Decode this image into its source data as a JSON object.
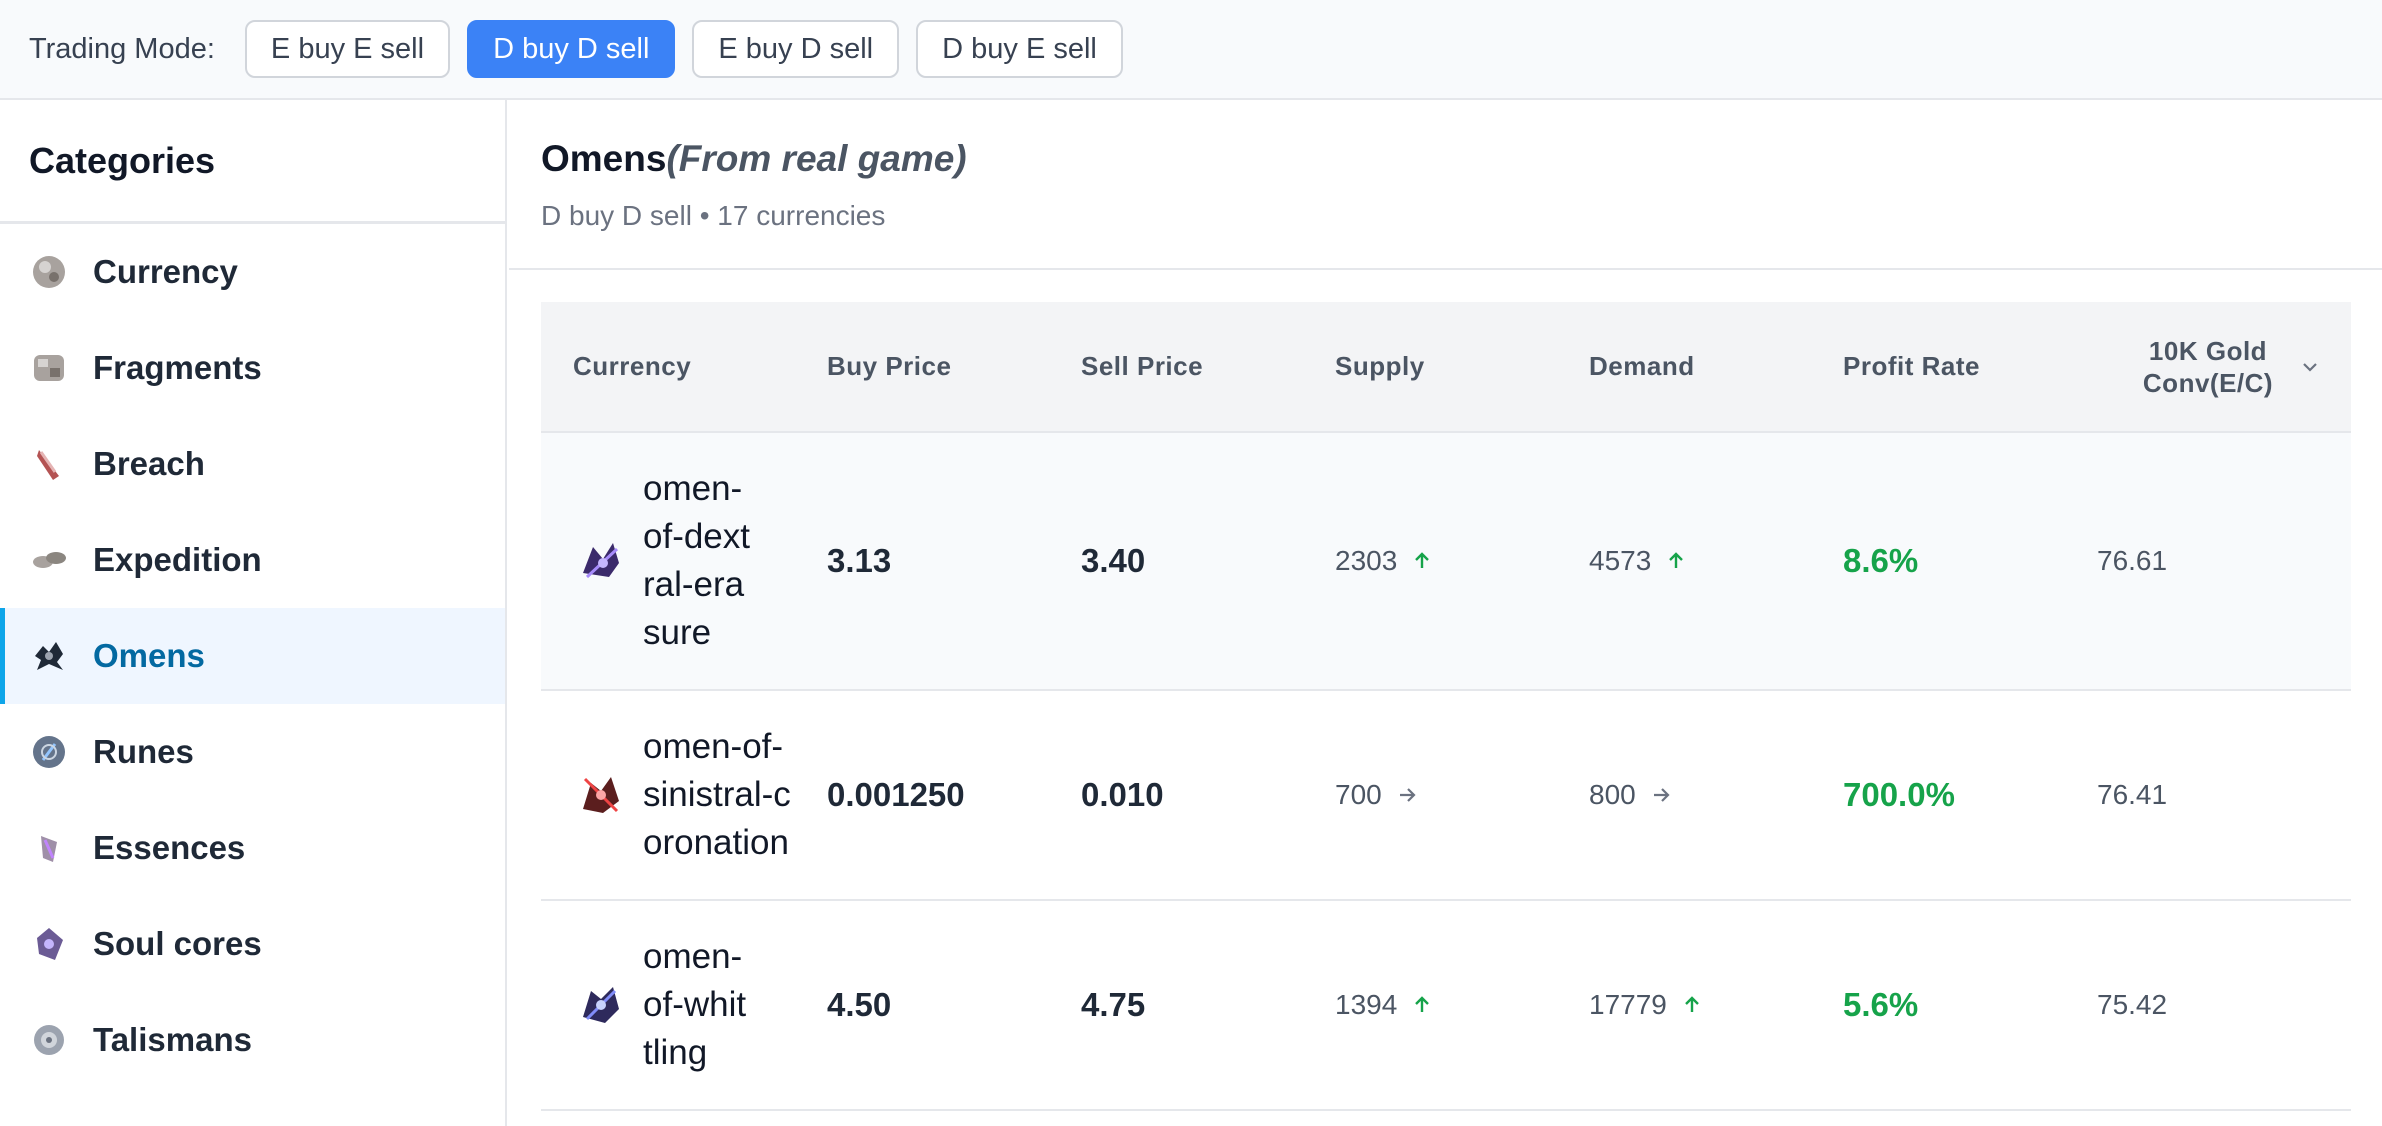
{
  "topbar": {
    "label": "Trading Mode:",
    "modes": [
      "E buy E sell",
      "D buy D sell",
      "E buy D sell",
      "D buy E sell"
    ],
    "active_mode": "D buy D sell"
  },
  "sidebar": {
    "title": "Categories",
    "items": [
      {
        "label": "Currency",
        "icon": "currency-orb-icon"
      },
      {
        "label": "Fragments",
        "icon": "fragment-icon"
      },
      {
        "label": "Breach",
        "icon": "breach-splinter-icon"
      },
      {
        "label": "Expedition",
        "icon": "expedition-artifact-icon"
      },
      {
        "label": "Omens",
        "icon": "omen-icon"
      },
      {
        "label": "Runes",
        "icon": "rune-icon"
      },
      {
        "label": "Essences",
        "icon": "essence-icon"
      },
      {
        "label": "Soul cores",
        "icon": "soul-core-icon"
      },
      {
        "label": "Talismans",
        "icon": "talisman-icon"
      }
    ],
    "active": "Omens"
  },
  "main": {
    "title": "Omens",
    "title_note": "(From real game)",
    "subtitle": "D buy D sell • 17 currencies"
  },
  "table": {
    "columns": [
      "Currency",
      "Buy Price",
      "Sell Price",
      "Supply",
      "Demand",
      "Profit Rate",
      "10K Gold Conv(E/C)"
    ],
    "rows": [
      {
        "currency": "omen-of-dextral-erasure",
        "buy": "3.13",
        "sell": "3.40",
        "supply": "2303",
        "supply_trend": "up",
        "demand": "4573",
        "demand_trend": "up",
        "profit": "8.6%",
        "conv": "76.61"
      },
      {
        "currency": "omen-of-sinistral-coronation",
        "buy": "0.001250",
        "sell": "0.010",
        "supply": "700",
        "supply_trend": "flat",
        "demand": "800",
        "demand_trend": "flat",
        "profit": "700.0%",
        "conv": "76.41"
      },
      {
        "currency": "omen-of-whittling",
        "buy": "4.50",
        "sell": "4.75",
        "supply": "1394",
        "supply_trend": "up",
        "demand": "17779",
        "demand_trend": "up",
        "profit": "5.6%",
        "conv": "75.42"
      }
    ]
  },
  "colors": {
    "accent": "#3b82f6",
    "active_category": "#0369a1",
    "profit": "#16a34a",
    "trend_up": "#16a34a",
    "trend_flat": "#6b7280"
  }
}
